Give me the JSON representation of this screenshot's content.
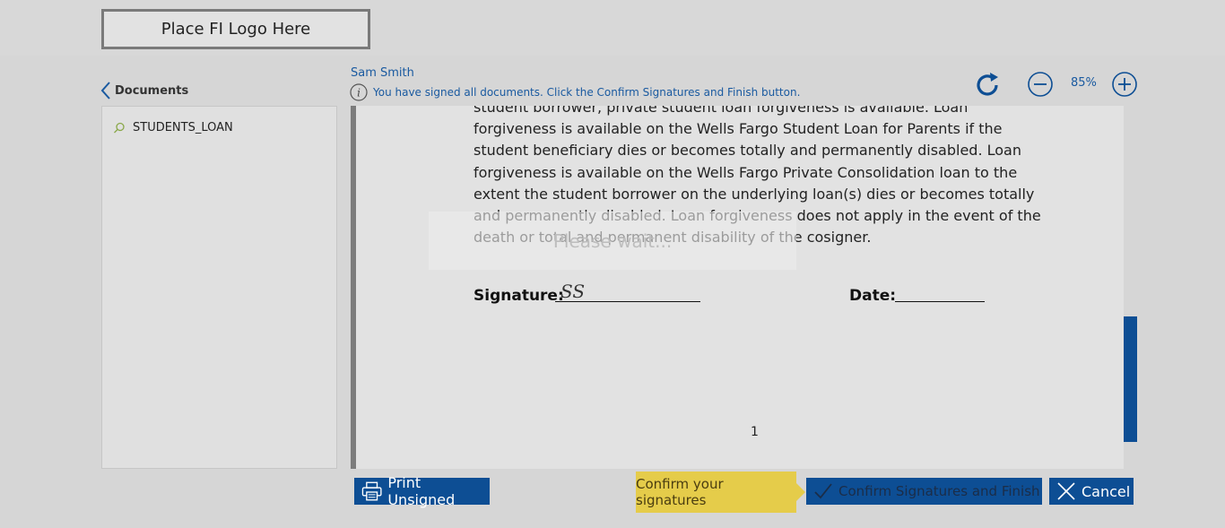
{
  "header": {
    "logo_text": "Place FI Logo Here"
  },
  "sidebar": {
    "title": "Documents",
    "items": [
      {
        "label": "STUDENTS_LOAN"
      }
    ]
  },
  "viewer_header": {
    "user_name": "Sam Smith",
    "info_message": "You have signed all documents. Click the Confirm Signatures and Finish button."
  },
  "toolbar": {
    "zoom": "85%"
  },
  "document": {
    "lines": [
      "student borrower, private student loan forgiveness is available. Loan",
      "forgiveness is available on the Wells Fargo Student Loan for Parents if the",
      "student beneficiary dies or becomes totally and permanently disabled. Loan",
      "forgiveness is available on the Wells Fargo Private Consolidation loan to the",
      "extent the student borrower on the underlying loan(s) dies or becomes totally",
      "and permanently disabled. Loan forgiveness does not apply in the event of the",
      "death or total and permanent disability of the cosigner."
    ],
    "signature_label": "Signature:",
    "signature_initials": "SS",
    "date_label": "Date:",
    "page_number": "1",
    "overlay_text": "Please wait..."
  },
  "footer": {
    "print_label": "Print Unsigned",
    "tooltip": "Confirm your signatures",
    "confirm_label": "Confirm Signatures and Finish",
    "cancel_label": "Cancel"
  },
  "colors": {
    "accent": "#0d4e94",
    "link": "#1a5aa0",
    "tooltip": "#e5cc4a"
  }
}
